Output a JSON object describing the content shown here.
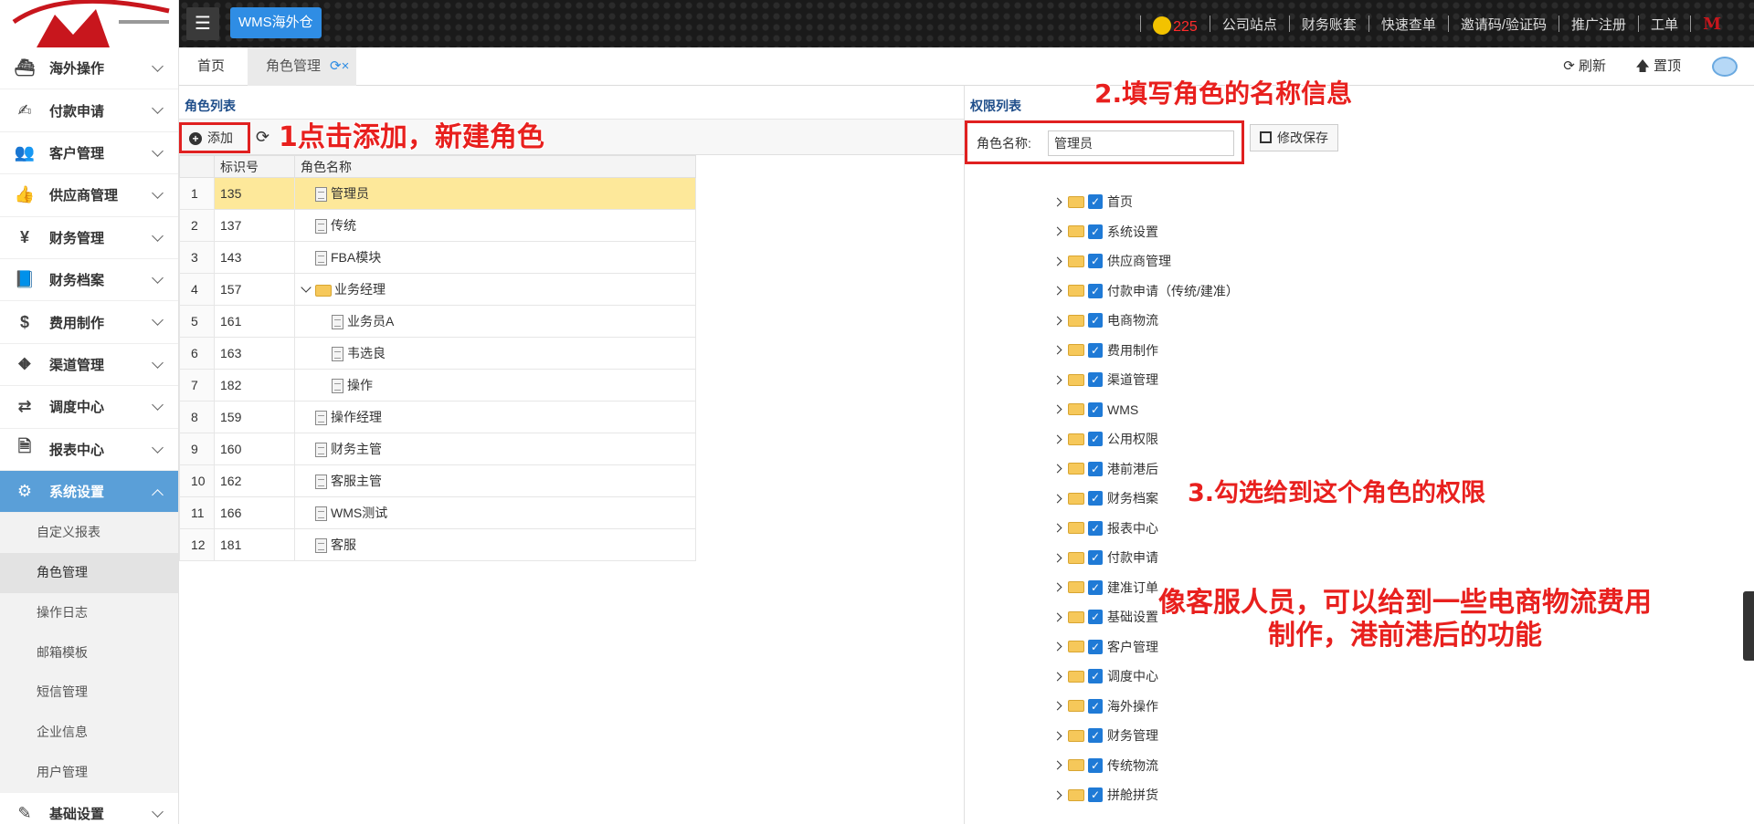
{
  "app": {
    "name": "WMS海外仓"
  },
  "topnav": {
    "notification_count": "225",
    "links": [
      "公司站点",
      "财务账套",
      "快速查单",
      "邀请码/验证码",
      "推广注册",
      "工单"
    ],
    "brand_letter": "M"
  },
  "sidebar": {
    "items": [
      {
        "label": "海外操作",
        "icon": "ship-icon",
        "glyph": "⛴"
      },
      {
        "label": "付款申请",
        "icon": "payment-icon",
        "glyph": "✍"
      },
      {
        "label": "客户管理",
        "icon": "users-icon",
        "glyph": "👥"
      },
      {
        "label": "供应商管理",
        "icon": "thumbs-up-icon",
        "glyph": "👍"
      },
      {
        "label": "财务管理",
        "icon": "yen-icon",
        "glyph": "¥"
      },
      {
        "label": "财务档案",
        "icon": "book-icon",
        "glyph": "📘"
      },
      {
        "label": "费用制作",
        "icon": "dollar-icon",
        "glyph": "$"
      },
      {
        "label": "渠道管理",
        "icon": "road-icon",
        "glyph": "⛖"
      },
      {
        "label": "调度中心",
        "icon": "retweet-icon",
        "glyph": "⇄"
      },
      {
        "label": "报表中心",
        "icon": "file-text-icon",
        "glyph": "🗎"
      },
      {
        "label": "系统设置",
        "icon": "gear-icon",
        "glyph": "⚙"
      }
    ],
    "submenu": [
      "自定义报表",
      "角色管理",
      "操作日志",
      "邮箱模板",
      "短信管理",
      "企业信息",
      "用户管理"
    ],
    "bottom_item": {
      "label": "基础设置",
      "icon": "edit-icon",
      "glyph": "✎"
    }
  },
  "tabs": {
    "home": "首页",
    "current": "角色管理",
    "refresh_label": "刷新",
    "top_label": "置顶"
  },
  "role_panel": {
    "title": "角色列表",
    "add_label": "添加",
    "columns": [
      "标识号",
      "角色名称"
    ],
    "rows": [
      {
        "n": "1",
        "id": "135",
        "name": "管理员"
      },
      {
        "n": "2",
        "id": "137",
        "name": "传统"
      },
      {
        "n": "3",
        "id": "143",
        "name": "FBA模块"
      },
      {
        "n": "4",
        "id": "157",
        "name": "业务经理"
      },
      {
        "n": "5",
        "id": "161",
        "name": "业务员A"
      },
      {
        "n": "6",
        "id": "163",
        "name": "韦选良"
      },
      {
        "n": "7",
        "id": "182",
        "name": "操作"
      },
      {
        "n": "8",
        "id": "159",
        "name": "操作经理"
      },
      {
        "n": "9",
        "id": "160",
        "name": "财务主管"
      },
      {
        "n": "10",
        "id": "162",
        "name": "客服主管"
      },
      {
        "n": "11",
        "id": "166",
        "name": "WMS测试"
      },
      {
        "n": "12",
        "id": "181",
        "name": "客服"
      }
    ]
  },
  "perm_panel": {
    "title": "权限列表",
    "name_label": "角色名称:",
    "name_value": "管理员",
    "save_label": "修改保存",
    "nodes": [
      "首页",
      "系统设置",
      "供应商管理",
      "付款申请（传统/建准）",
      "电商物流",
      "费用制作",
      "渠道管理",
      "WMS",
      "公用权限",
      "港前港后",
      "财务档案",
      "报表中心",
      "付款申请",
      "建准订单",
      "基础设置",
      "客户管理",
      "调度中心",
      "海外操作",
      "财务管理",
      "传统物流",
      "拼舱拼货"
    ]
  },
  "annotations": {
    "step1": "1点击添加，新建角色",
    "step2": "2.填写角色的名称信息",
    "step3": "3.勾选给到这个角色的权限",
    "note": "像客服人员，可以给到一些电商物流费用制作，港前港后的功能"
  },
  "colors": {
    "accent": "#2f8de4",
    "active_menu": "#5a9fd8",
    "annotation": "#e8201e",
    "selected_row": "#fde89a"
  }
}
